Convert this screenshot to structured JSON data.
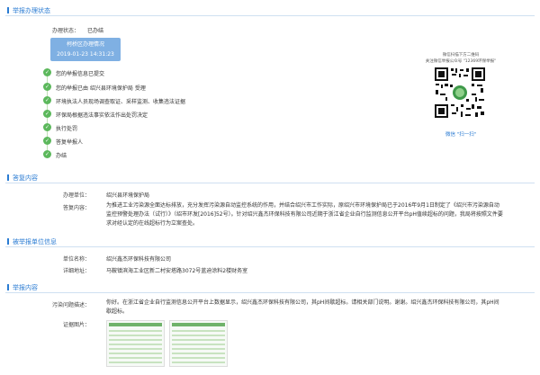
{
  "status_section": {
    "title": "举报办理状态",
    "status_label": "办理状态：",
    "status_value": "已办结"
  },
  "timeline": {
    "date_title": "柯桥区办理情况",
    "date": "2019-01-23 14:31:23",
    "steps": [
      "您的举报信息已提交",
      "您的举报已由 绍兴县环境保护局 受理",
      "环境执法人员现场调查取证、采样监测、收集违法证据",
      "环保局根据违法事实依法作出处罚决定",
      "执行处罚",
      "答复举报人",
      "办结"
    ],
    "check_glyph": "✓"
  },
  "qr": {
    "caption_line1": "微信扫描下方二维码",
    "caption_line2": "关注微信举报公众号 \"12369环保举报\"",
    "scan_label": "微信 \"扫一扫\""
  },
  "reply_section": {
    "title": "答复内容",
    "unit_label": "办理单位：",
    "unit_value": "绍兴县环境保护局",
    "reply_label": "答复内容：",
    "reply_text": "为推进工业污染源全面达标排放，充分发挥污染源自动监控系统的作用，并结合绍兴市工作实际，原绍兴市环境保护局已于2016年9月1日制定了《绍兴市污染源自动监控预警处理办法（试行）》（绍市环发[2016]52号）。针对绍兴鑫杰环保科技有限公司近期于浙江省企业自行监测信息公开平台pH值续超标的问题，我局将按照文件要求对经认定的在线超标行为立案查处。"
  },
  "reported_section": {
    "title": "被举报单位信息",
    "name_label": "单位名称：",
    "name_value": "绍兴鑫杰环保科技有限公司",
    "address_label": "详细地址：",
    "address_value": "马鞍镇滨海工业区新二村安塔路3072号蓝迪涂料2楼财务室"
  },
  "report_section": {
    "title": "举报内容",
    "desc_label": "污染问题描述：",
    "desc_text": "你好。在浙江省企业自行监测信息公开平台上数据显示，绍兴鑫杰环保科技有限公司，其pH间歇超标。请相关部门说明。谢谢。绍兴鑫杰环保科技有限公司，其pH间歇超标。",
    "evidence_label": "证据图片："
  }
}
